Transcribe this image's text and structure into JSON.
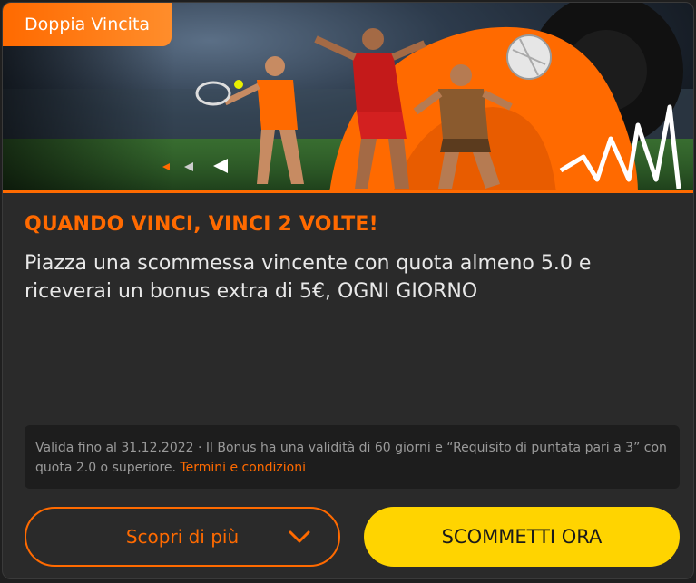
{
  "banner": {
    "tag_label": "Doppia Vincita"
  },
  "promo": {
    "headline": "QUANDO VINCI, VINCI 2 VOLTE!",
    "description": "Piazza una scommessa vincente con quota almeno 5.0 e riceverai un bonus extra di 5€, OGNI GIORNO"
  },
  "terms": {
    "text": "Valida fino al 31.12.2022 · Il Bonus ha una validità di 60 giorni e “Requisito di puntata pari a 3” con quota 2.0 o superiore.",
    "link_label": "Termini e condizioni"
  },
  "actions": {
    "more_label": "Scopri di più",
    "bet_label": "SCOMMETTI ORA"
  },
  "colors": {
    "accent": "#ff6a00",
    "cta": "#ffd400",
    "card_bg": "#2a2a2a"
  }
}
